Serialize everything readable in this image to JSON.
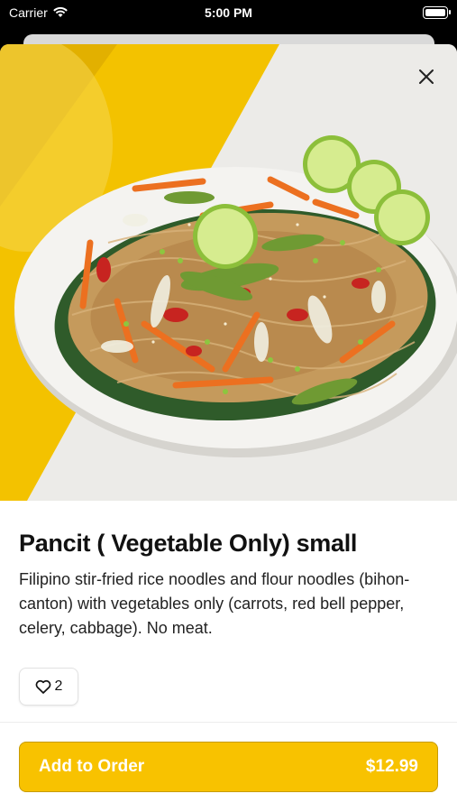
{
  "status_bar": {
    "carrier": "Carrier",
    "time": "5:00 PM"
  },
  "item": {
    "title": "Pancit ( Vegetable Only) small",
    "description": "Filipino stir-fried rice noodles and flour noodles (bihon-canton) with  vegetables only (carrots, red bell pepper, celery, cabbage). No meat.",
    "likes": "2"
  },
  "order": {
    "label": "Add to Order",
    "price": "$12.99"
  },
  "colors": {
    "accent": "#f8c200",
    "background_yellow": "#f3c200"
  },
  "icons": {
    "close": "close-icon",
    "like": "heart-icon",
    "wifi": "wifi-icon",
    "battery": "battery-icon"
  }
}
